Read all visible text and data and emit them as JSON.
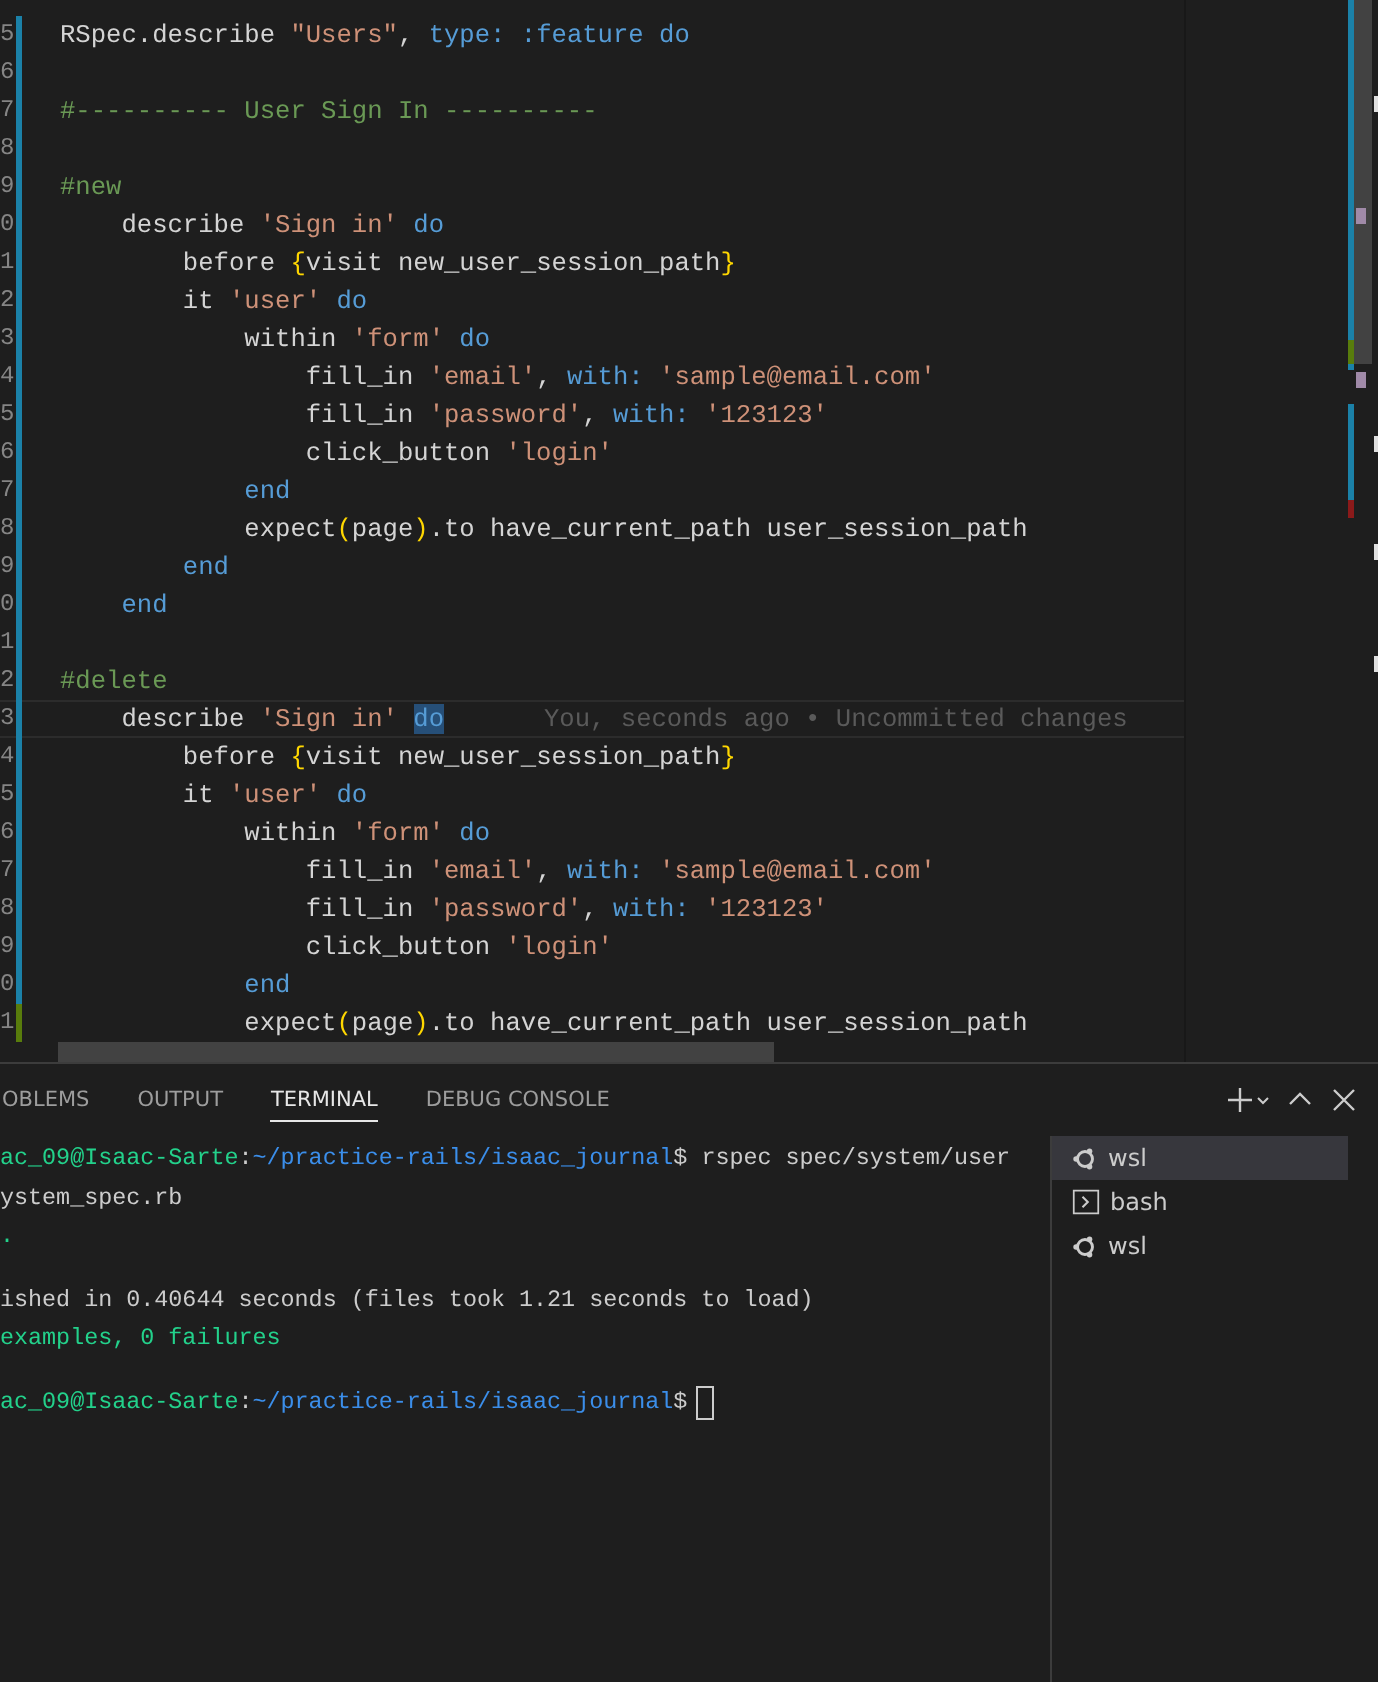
{
  "editor": {
    "lines": [
      {
        "number": "5",
        "kind": "modified",
        "tokens": [
          {
            "text": "RSpec.describe ",
            "kind": "plain"
          },
          {
            "text": "\"Users\"",
            "kind": "string"
          },
          {
            "text": ", ",
            "kind": "plain"
          },
          {
            "text": "type: :feature do",
            "kind": "keyword"
          }
        ]
      },
      {
        "number": "6",
        "kind": "modified"
      },
      {
        "number": "7",
        "kind": "modified",
        "tokens": [
          {
            "text": "#---------- User Sign In ----------",
            "kind": "comment"
          }
        ]
      },
      {
        "number": "8",
        "kind": "modified"
      },
      {
        "number": "9",
        "kind": "modified",
        "tokens": [
          {
            "text": "#new",
            "kind": "comment"
          }
        ]
      },
      {
        "number": "0",
        "kind": "modified",
        "tokens": [
          {
            "text": "    describe ",
            "kind": "plain"
          },
          {
            "text": "'Sign in'",
            "kind": "string"
          },
          {
            "text": " do",
            "kind": "keyword"
          }
        ]
      },
      {
        "number": "1",
        "kind": "modified",
        "tokens": [
          {
            "text": "        before ",
            "kind": "plain"
          },
          {
            "text": "{",
            "kind": "bracket"
          },
          {
            "text": "visit new_user_session_path",
            "kind": "plain"
          },
          {
            "text": "}",
            "kind": "bracket"
          }
        ]
      },
      {
        "number": "2",
        "kind": "modified",
        "tokens": [
          {
            "text": "        it ",
            "kind": "plain"
          },
          {
            "text": "'user'",
            "kind": "string"
          },
          {
            "text": " do",
            "kind": "keyword"
          }
        ]
      },
      {
        "number": "3",
        "kind": "modified",
        "tokens": [
          {
            "text": "            within ",
            "kind": "plain"
          },
          {
            "text": "'form'",
            "kind": "string"
          },
          {
            "text": " do",
            "kind": "keyword"
          }
        ]
      },
      {
        "number": "4",
        "kind": "modified",
        "tokens": [
          {
            "text": "                fill_in ",
            "kind": "plain"
          },
          {
            "text": "'email'",
            "kind": "string"
          },
          {
            "text": ", ",
            "kind": "plain"
          },
          {
            "text": "with:",
            "kind": "keyword"
          },
          {
            "text": " 'sample@email.com'",
            "kind": "string"
          }
        ]
      },
      {
        "number": "5",
        "kind": "modified",
        "tokens": [
          {
            "text": "                fill_in ",
            "kind": "plain"
          },
          {
            "text": "'password'",
            "kind": "string"
          },
          {
            "text": ", ",
            "kind": "plain"
          },
          {
            "text": "with:",
            "kind": "keyword"
          },
          {
            "text": " '123123'",
            "kind": "string"
          }
        ]
      },
      {
        "number": "6",
        "kind": "modified",
        "tokens": [
          {
            "text": "                click_button ",
            "kind": "plain"
          },
          {
            "text": "'login'",
            "kind": "string"
          }
        ]
      },
      {
        "number": "7",
        "kind": "modified",
        "tokens": [
          {
            "text": "            end",
            "kind": "keyword"
          }
        ]
      },
      {
        "number": "8",
        "kind": "modified",
        "tokens": [
          {
            "text": "            expect",
            "kind": "plain"
          },
          {
            "text": "(",
            "kind": "bracket"
          },
          {
            "text": "page",
            "kind": "plain"
          },
          {
            "text": ")",
            "kind": "bracket"
          },
          {
            "text": ".to have_current_path user_session_path",
            "kind": "plain"
          }
        ]
      },
      {
        "number": "9",
        "kind": "modified",
        "tokens": [
          {
            "text": "        end",
            "kind": "keyword"
          }
        ]
      },
      {
        "number": "0",
        "kind": "modified",
        "tokens": [
          {
            "text": "    end",
            "kind": "keyword"
          }
        ]
      },
      {
        "number": "1",
        "kind": "modified"
      },
      {
        "number": "2",
        "kind": "modified",
        "tokens": [
          {
            "text": "#delete",
            "kind": "comment"
          }
        ]
      },
      {
        "number": "3",
        "kind": "modified",
        "current": true,
        "blame": "You, seconds ago • Uncommitted changes",
        "tokens": [
          {
            "text": "    describe ",
            "kind": "plain"
          },
          {
            "text": "'Sign in' ",
            "kind": "string"
          },
          {
            "text": "do",
            "kind": "match"
          }
        ]
      },
      {
        "number": "4",
        "kind": "modified",
        "tokens": [
          {
            "text": "        before ",
            "kind": "plain"
          },
          {
            "text": "{",
            "kind": "bracket"
          },
          {
            "text": "visit new_user_session_path",
            "kind": "plain"
          },
          {
            "text": "}",
            "kind": "bracket"
          }
        ]
      },
      {
        "number": "5",
        "kind": "modified",
        "tokens": [
          {
            "text": "        it ",
            "kind": "plain"
          },
          {
            "text": "'user'",
            "kind": "string"
          },
          {
            "text": " do",
            "kind": "keyword"
          }
        ]
      },
      {
        "number": "6",
        "kind": "modified",
        "tokens": [
          {
            "text": "            within ",
            "kind": "plain"
          },
          {
            "text": "'form'",
            "kind": "string"
          },
          {
            "text": " do",
            "kind": "keyword"
          }
        ]
      },
      {
        "number": "7",
        "kind": "modified",
        "tokens": [
          {
            "text": "                fill_in ",
            "kind": "plain"
          },
          {
            "text": "'email'",
            "kind": "string"
          },
          {
            "text": ", ",
            "kind": "plain"
          },
          {
            "text": "with:",
            "kind": "keyword"
          },
          {
            "text": " 'sample@email.com'",
            "kind": "string"
          }
        ]
      },
      {
        "number": "8",
        "kind": "modified",
        "tokens": [
          {
            "text": "                fill_in ",
            "kind": "plain"
          },
          {
            "text": "'password'",
            "kind": "string"
          },
          {
            "text": ", ",
            "kind": "plain"
          },
          {
            "text": "with:",
            "kind": "keyword"
          },
          {
            "text": " '123123'",
            "kind": "string"
          }
        ]
      },
      {
        "number": "9",
        "kind": "modified",
        "tokens": [
          {
            "text": "                click_button ",
            "kind": "plain"
          },
          {
            "text": "'login'",
            "kind": "string"
          }
        ]
      },
      {
        "number": "0",
        "kind": "modified",
        "tokens": [
          {
            "text": "            end",
            "kind": "keyword"
          }
        ]
      },
      {
        "number": "1",
        "kind": "added",
        "tokens": [
          {
            "text": "            expect",
            "kind": "plain"
          },
          {
            "text": "(",
            "kind": "bracket"
          },
          {
            "text": "page",
            "kind": "plain"
          },
          {
            "text": ")",
            "kind": "bracket"
          },
          {
            "text": ".to have_current_path user_session_path",
            "kind": "plain"
          }
        ]
      }
    ]
  },
  "panel": {
    "tabs": [
      {
        "label": "OBLEMS",
        "selected": false
      },
      {
        "label": "OUTPUT",
        "selected": false
      },
      {
        "label": "TERMINAL",
        "selected": true
      },
      {
        "label": "DEBUG CONSOLE",
        "selected": false
      }
    ],
    "terminal": {
      "lines": [
        {
          "segments": [
            {
              "text": "ac_09@Isaac-Sarte",
              "kind": "user"
            },
            {
              "text": ":",
              "kind": "plain"
            },
            {
              "text": "~/practice-rails/isaac_journal",
              "kind": "path"
            },
            {
              "text": "$ rspec spec/system/user",
              "kind": "plain"
            }
          ]
        },
        {
          "segments": [
            {
              "text": "ystem_spec.rb",
              "kind": "plain"
            }
          ]
        },
        {
          "segments": [
            {
              "text": ".",
              "kind": "success"
            }
          ]
        },
        {
          "blank_before": true,
          "segments": [
            {
              "text": "ished in 0.40644 seconds (files took 1.21 seconds to load)",
              "kind": "plain"
            }
          ]
        },
        {
          "segments": [
            {
              "text": "examples, 0 failures",
              "kind": "success"
            }
          ]
        },
        {
          "blank_before": true,
          "cursor": true,
          "segments": [
            {
              "text": "ac_09@Isaac-Sarte",
              "kind": "user"
            },
            {
              "text": ":",
              "kind": "plain"
            },
            {
              "text": "~/practice-rails/isaac_journal",
              "kind": "path"
            },
            {
              "text": "$",
              "kind": "plain"
            }
          ]
        }
      ]
    },
    "sessions": [
      {
        "name": "wsl",
        "kind": "linux",
        "selected": true
      },
      {
        "name": "bash",
        "kind": "shell",
        "selected": false
      },
      {
        "name": "wsl",
        "kind": "linux",
        "selected": false
      }
    ]
  }
}
